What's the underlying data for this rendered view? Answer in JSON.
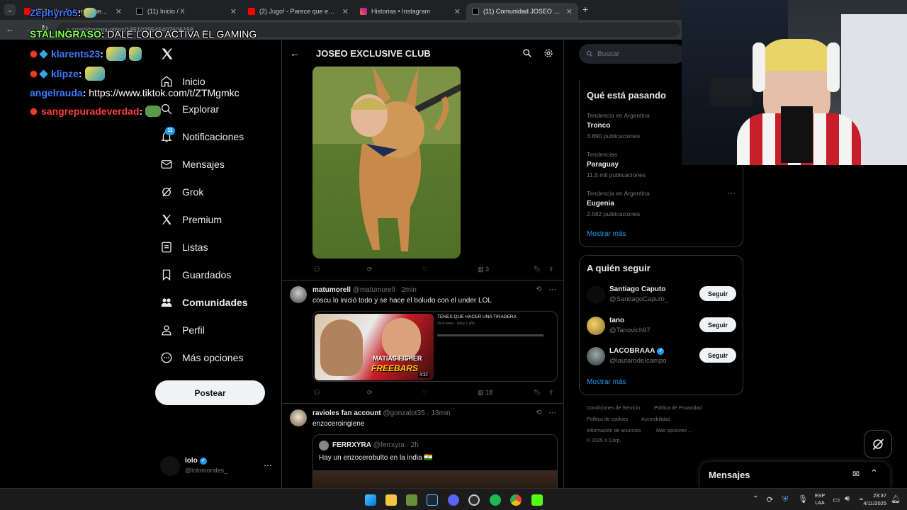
{
  "browser": {
    "tabs": [
      {
        "title": "(2) Matias Fisher - Muerte en H",
        "color": "#ff0000",
        "active": false
      },
      {
        "title": "(11) Inicio / X",
        "color": "#ffffff",
        "active": false
      },
      {
        "title": "(2) Jugo! - Parece que entreno",
        "color": "#ff0000",
        "active": false
      },
      {
        "title": "Historias • Instagram",
        "color": "#d6249f",
        "active": false
      },
      {
        "title": "(11) Comunidad JOSEO EXCLUSI",
        "color": "#ffffff",
        "active": true
      }
    ],
    "new_tab": "+",
    "url": "x.com/i/communities/1851039545407606158"
  },
  "chat": [
    {
      "user": "Zephyrr05",
      "color": "#3d7bff",
      "message": ""
    },
    {
      "user": "STALINGRASO",
      "color": "#7cfc4f",
      "message": "DALE LOLO ACTIVA EL GAMING"
    },
    {
      "user": "klarents23",
      "color": "#3d7bff",
      "message": ""
    },
    {
      "user": "klipze",
      "color": "#3d7bff",
      "message": ""
    },
    {
      "user": "angelrauda",
      "color": "#3d7bff",
      "message": "https://www.tiktok.com/t/ZTMgmkc"
    },
    {
      "user": "sangrepuradeverdad",
      "color": "#ff3b3b",
      "message": ""
    }
  ],
  "nav": {
    "items": [
      {
        "label": "Inicio",
        "icon": "home-icon"
      },
      {
        "label": "Explorar",
        "icon": "search-icon"
      },
      {
        "label": "Notificaciones",
        "icon": "bell-icon",
        "badge": "11"
      },
      {
        "label": "Mensajes",
        "icon": "mail-icon"
      },
      {
        "label": "Grok",
        "icon": "grok-icon"
      },
      {
        "label": "Premium",
        "icon": "x-premium-icon"
      },
      {
        "label": "Listas",
        "icon": "list-icon"
      },
      {
        "label": "Guardados",
        "icon": "bookmark-icon"
      },
      {
        "label": "Comunidades",
        "icon": "communities-icon"
      },
      {
        "label": "Perfil",
        "icon": "profile-icon"
      },
      {
        "label": "Más opciones",
        "icon": "more-icon"
      }
    ],
    "post_label": "Postear",
    "account": {
      "name": "lolo",
      "handle": "@lolomorales_"
    }
  },
  "main": {
    "title": "JOSEO EXCLUSIVE CLUB",
    "tweets": [
      {
        "views": "3"
      },
      {
        "name": "matumorell",
        "handle": "@matumorell",
        "time": "2min",
        "text": "coscu lo inició todo y se hace el boludo con el under LOL",
        "preview": {
          "headline": "TENES QUE HACER UNA TIRADERA",
          "subline": "29.4 views · hace 1 año",
          "thumb_text": "MATIAS FISHER",
          "thumb_text2": "FREEBARS",
          "duration": "4:32"
        },
        "views": "18"
      },
      {
        "name": "ravioles fan account",
        "handle": "@gonzalot35",
        "time": "13min",
        "text": "enzoceroingiene",
        "quote": {
          "name": "FERRXYRA",
          "handle": "@ferrxyra",
          "time": "2h",
          "text": "Hay un enzocerobulto en la india 🇮🇳"
        }
      }
    ]
  },
  "right": {
    "search_placeholder": "Buscar",
    "trends_title": "Qué está pasando",
    "trends": [
      {
        "meta": "Tendencia en Argentina",
        "name": "Tronco",
        "count": "3.890 publicaciones"
      },
      {
        "meta": "Tendencias",
        "name": "Paraguay",
        "count": "11,5 mil publicaciones"
      },
      {
        "meta": "Tendencia en Argentina",
        "name": "Eugenia",
        "count": "2.582 publicaciones"
      }
    ],
    "show_more": "Mostrar más",
    "follow_title": "A quién seguir",
    "follow": [
      {
        "name": "Santiago Caputo",
        "handle": "@SantiagoCaputo_",
        "verified": false
      },
      {
        "name": "tano",
        "handle": "@Tanovich97",
        "verified": false
      },
      {
        "name": "LACOBRAAA",
        "handle": "@lautarodeIcampo",
        "verified": true
      }
    ],
    "follow_button": "Seguir",
    "footer": [
      "Condiciones de Servicio",
      "Política de Privacidad",
      "Política de cookies",
      "Accesibilidad",
      "Información de anuncios",
      "Más opciones ...",
      "© 2025 X Corp."
    ],
    "messages_label": "Mensajes"
  },
  "taskbar": {
    "lang": "ESP",
    "lang2": "LAA",
    "time": "23:37",
    "date": "4/11/2025"
  },
  "colors": {
    "accent": "#1d9bf0",
    "verified": "#1d9bf0",
    "bg": "#000000"
  }
}
